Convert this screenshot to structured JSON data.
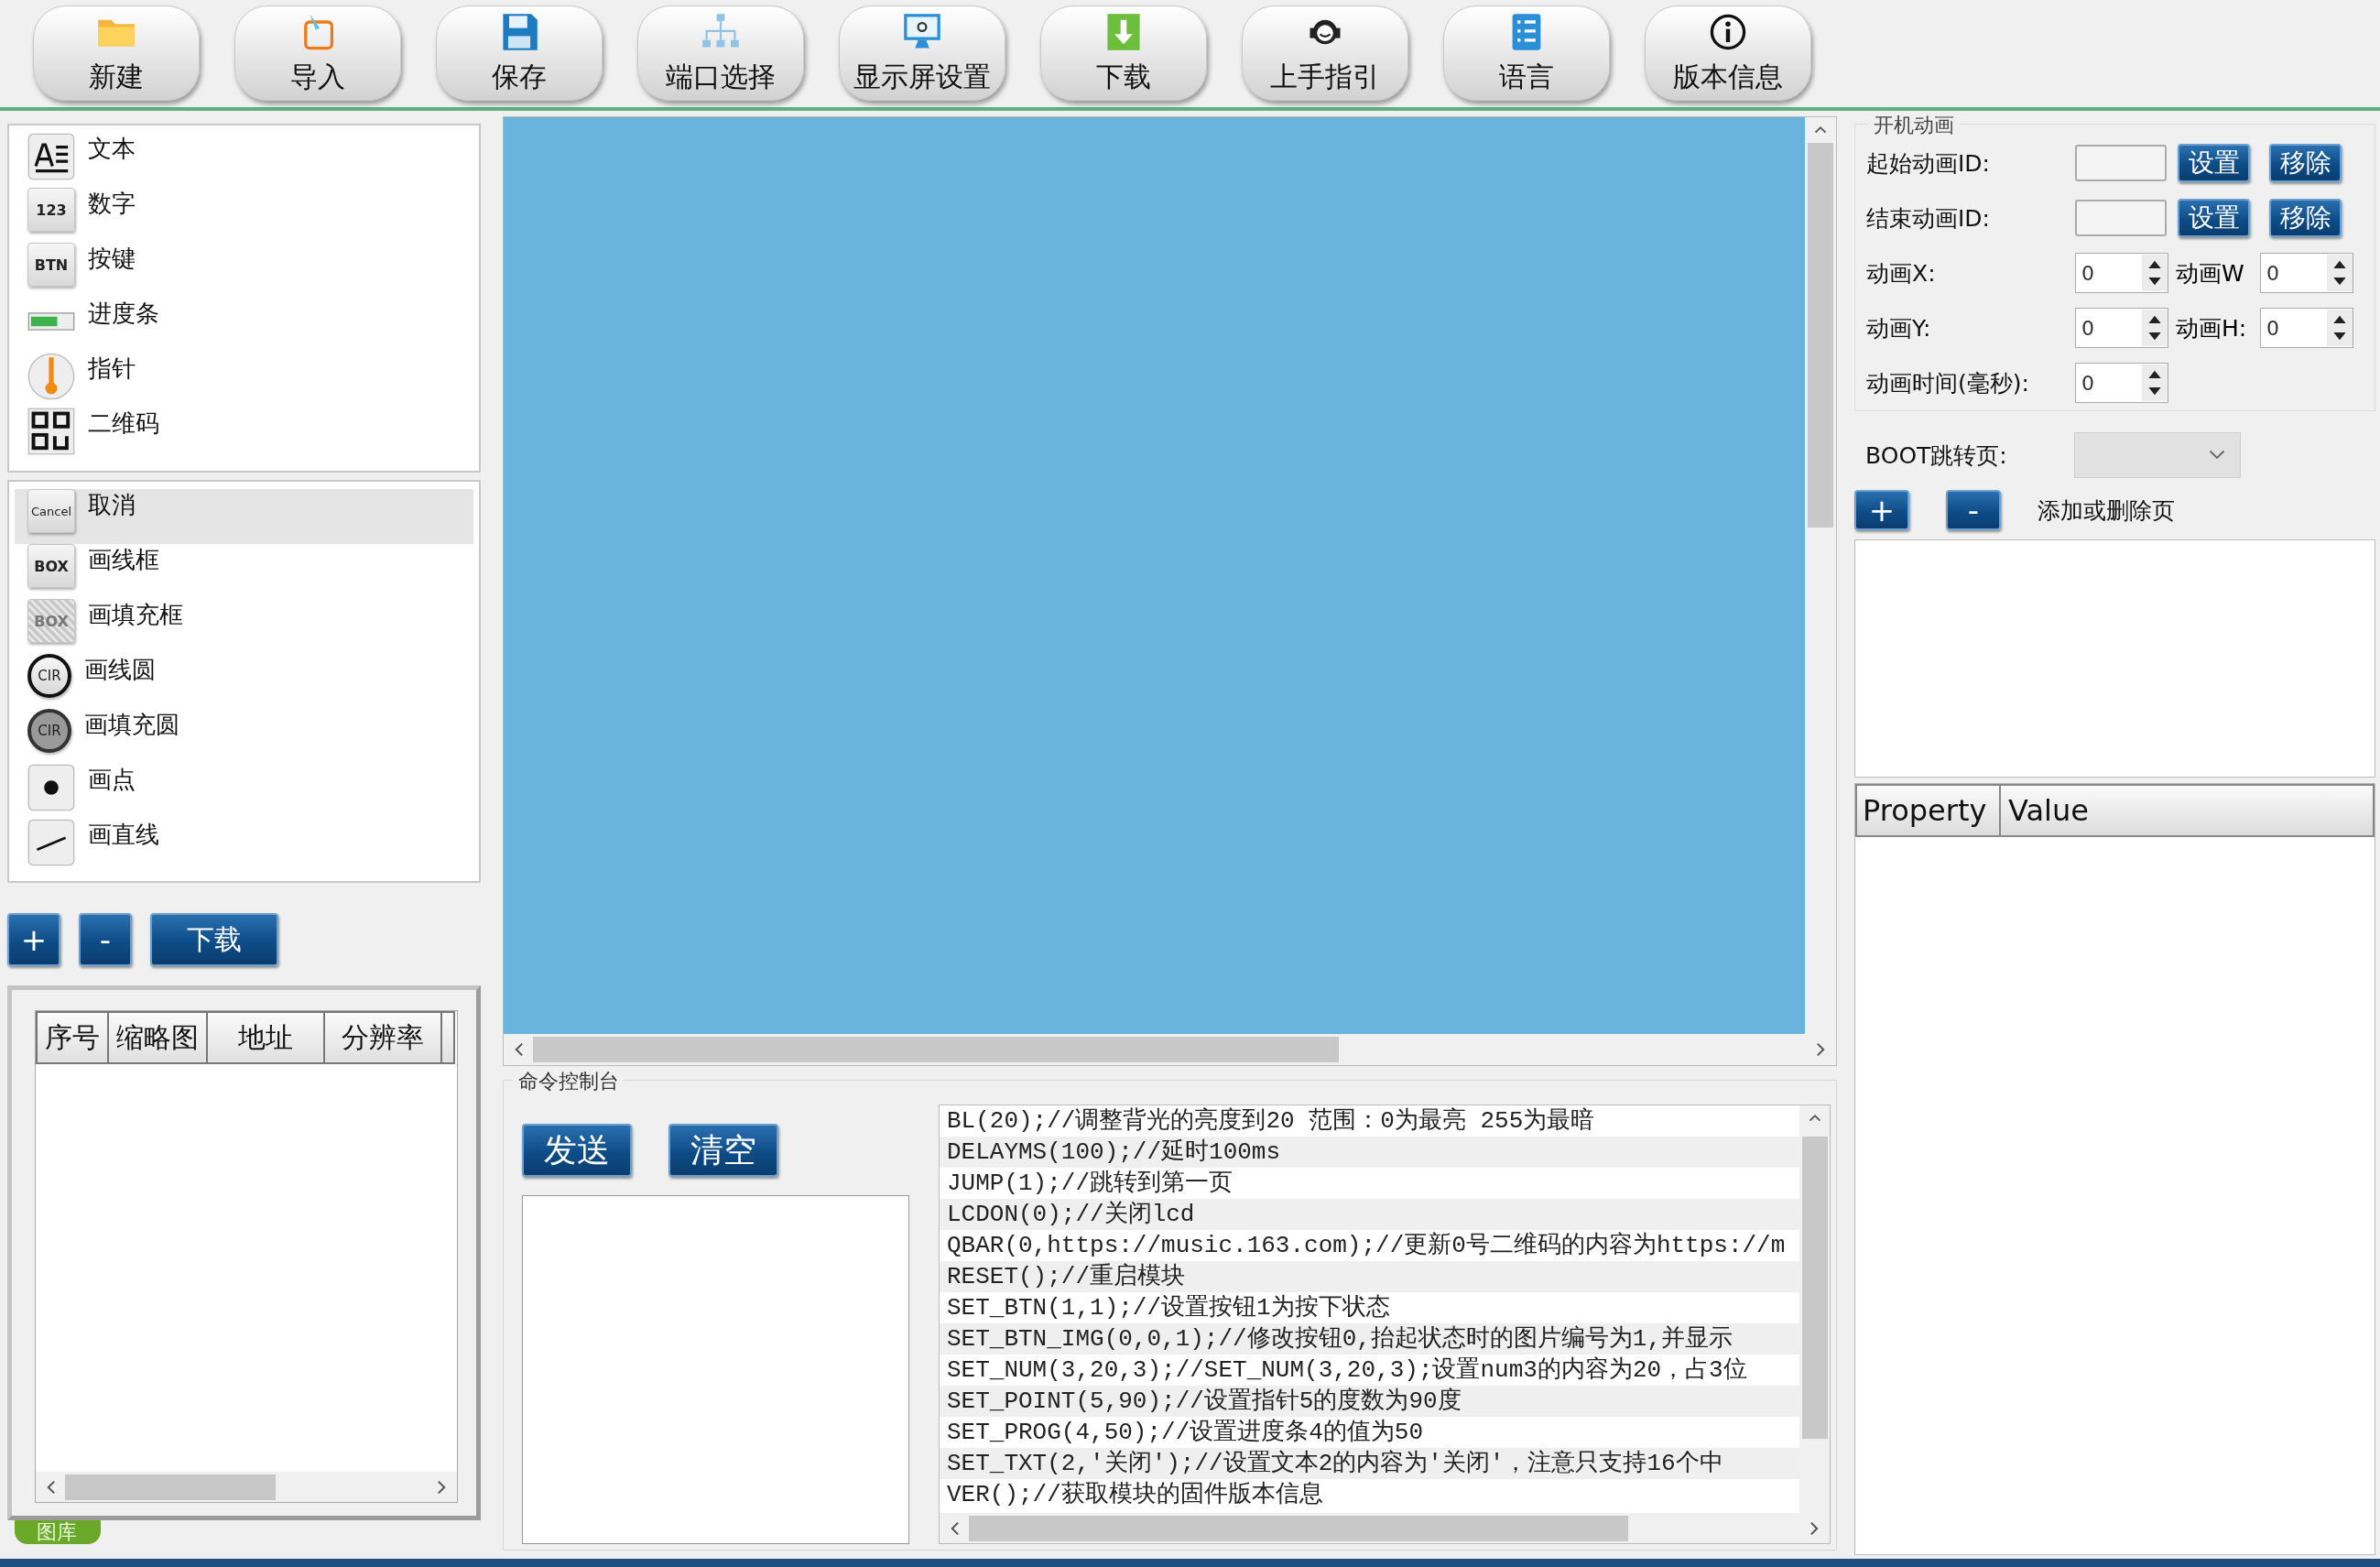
{
  "toolbar": [
    {
      "label": "新建"
    },
    {
      "label": "导入"
    },
    {
      "label": "保存"
    },
    {
      "label": "端口选择"
    },
    {
      "label": "显示屏设置"
    },
    {
      "label": "下载"
    },
    {
      "label": "上手指引"
    },
    {
      "label": "语言"
    },
    {
      "label": "版本信息"
    }
  ],
  "widgets": [
    {
      "label": "文本"
    },
    {
      "label": "数字",
      "badge": "123"
    },
    {
      "label": "按键",
      "badge": "BTN"
    },
    {
      "label": "进度条"
    },
    {
      "label": "指针"
    },
    {
      "label": "二维码"
    }
  ],
  "draw_tools": [
    {
      "label": "取消",
      "badge": "Cancel",
      "selected": true
    },
    {
      "label": "画线框",
      "badge": "BOX",
      "selected": false
    },
    {
      "label": "画填充框",
      "badge": "BOX",
      "selected": false
    },
    {
      "label": "画线圆",
      "badge": "CIR",
      "selected": false
    },
    {
      "label": "画填充圆",
      "badge": "CIR",
      "selected": false
    },
    {
      "label": "画点",
      "selected": false
    },
    {
      "label": "画直线",
      "selected": false
    }
  ],
  "gallery": {
    "buttons": [
      "+",
      "-",
      "下载"
    ],
    "columns": [
      "序号",
      "缩略图",
      "地址",
      "分辨率"
    ],
    "tab": "图库"
  },
  "console": {
    "title": "命令控制台",
    "buttons": [
      "发送",
      "清空"
    ],
    "commands": [
      "BL(20);//调整背光的亮度到20 范围：0为最亮 255为最暗",
      "DELAYMS(100);//延时100ms",
      "JUMP(1);//跳转到第一页",
      "LCDON(0);//关闭lcd",
      "QBAR(0,https://music.163.com);//更新0号二维码的内容为https://m",
      "RESET();//重启模块",
      "SET_BTN(1,1);//设置按钮1为按下状态",
      "SET_BTN_IMG(0,0,1);//修改按钮0,抬起状态时的图片编号为1,并显示",
      "SET_NUM(3,20,3);//SET_NUM(3,20,3);设置num3的内容为20，占3位",
      "SET_POINT(5,90);//设置指针5的度数为90度",
      "SET_PROG(4,50);//设置进度条4的值为50",
      "SET_TXT(2,'关闭');//设置文本2的内容为'关闭'，注意只支持16个中",
      "VER();//获取模块的固件版本信息"
    ]
  },
  "boot_animation": {
    "title": "开机动画",
    "id_rows": [
      {
        "label": "起始动画ID:",
        "buttons": [
          "设置",
          "移除"
        ]
      },
      {
        "label": "结束动画ID:",
        "buttons": [
          "设置",
          "移除"
        ]
      }
    ],
    "spin_rows": [
      {
        "label": "动画X:",
        "value": "0",
        "label2": "动画W",
        "value2": "0"
      },
      {
        "label": "动画Y:",
        "value": "0",
        "label2": "动画H:",
        "value2": "0"
      },
      {
        "label": "动画时间(毫秒):",
        "value": "0"
      }
    ]
  },
  "boot_page": {
    "label": "BOOT跳转页:"
  },
  "pages": {
    "buttons": [
      "+",
      "-"
    ],
    "hint": "添加或删除页"
  },
  "property_grid": {
    "columns": [
      "Property",
      "Value"
    ]
  }
}
